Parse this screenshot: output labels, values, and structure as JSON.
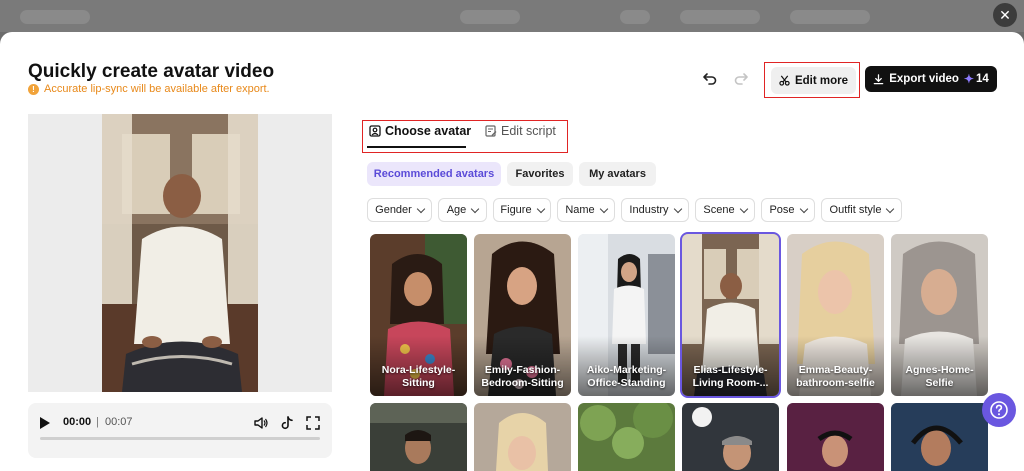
{
  "header": {
    "title": "Quickly create avatar video",
    "notice": "Accurate lip-sync will be available after export.",
    "edit_more_label": "Edit more",
    "export_label": "Export video",
    "export_cost": "14"
  },
  "player": {
    "current_time": "00:00",
    "separator": "|",
    "total_time": "00:07"
  },
  "tabs": [
    {
      "label": "Choose avatar",
      "active": true
    },
    {
      "label": "Edit script",
      "active": false
    }
  ],
  "categories": [
    {
      "label": "Recommended avatars",
      "active": true
    },
    {
      "label": "Favorites",
      "active": false
    },
    {
      "label": "My avatars",
      "active": false
    }
  ],
  "filters": [
    "Gender",
    "Age",
    "Figure",
    "Name",
    "Industry",
    "Scene",
    "Pose",
    "Outfit style"
  ],
  "avatars": [
    {
      "label": "Nora-Lifestyle-Sitting",
      "selected": false
    },
    {
      "label": "Emily-Fashion-Bedroom-Sitting",
      "selected": false
    },
    {
      "label": "Aiko-Marketing-Office-Standing",
      "selected": false
    },
    {
      "label": "Elias-Lifestyle-Living Room-...",
      "selected": true
    },
    {
      "label": "Emma-Beauty-bathroom-selfie",
      "selected": false
    },
    {
      "label": "Agnes-Home-Selfie",
      "selected": false
    }
  ],
  "colors": {
    "accent": "#6a57e0",
    "highlight_frame": "#e02424",
    "notice": "#e8891a"
  }
}
